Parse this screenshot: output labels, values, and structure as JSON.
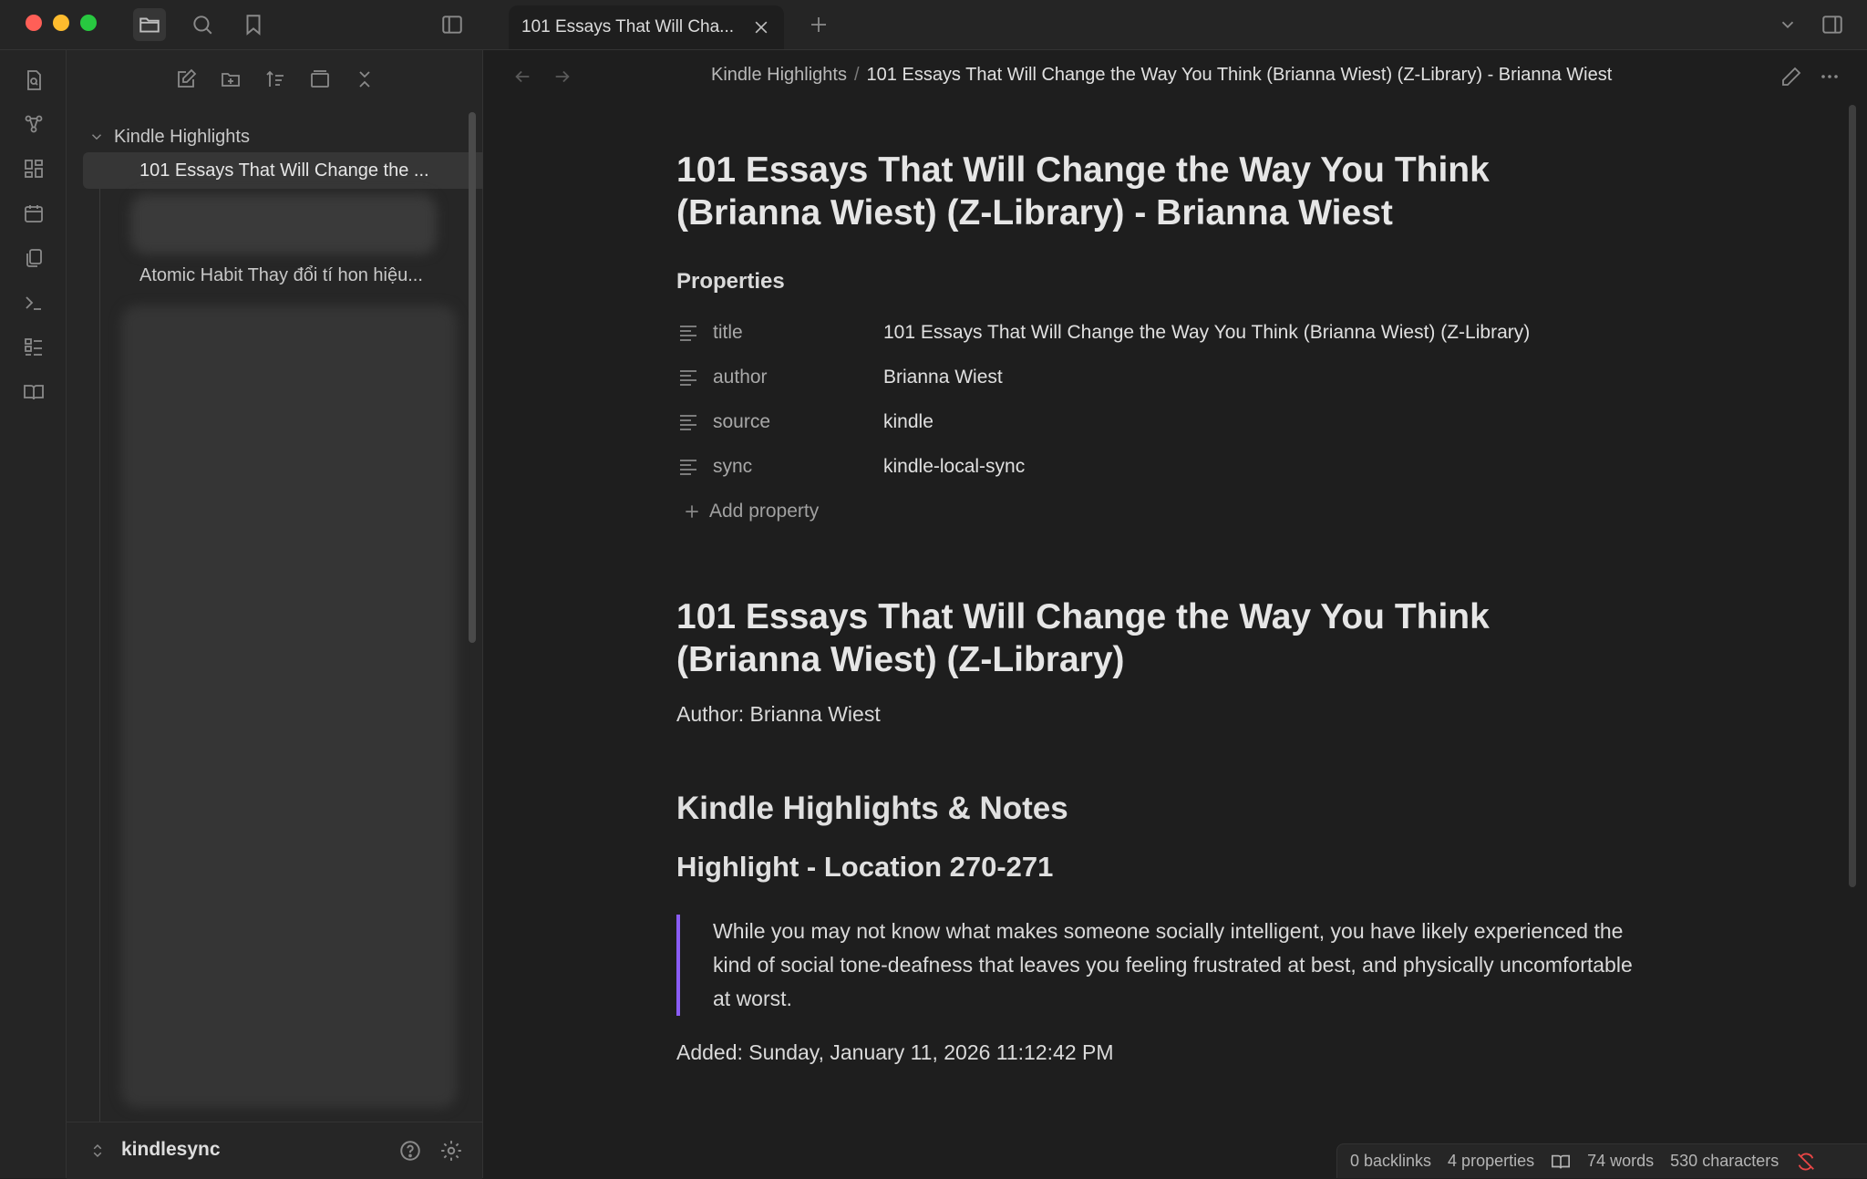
{
  "tab": {
    "title": "101 Essays That Will Cha..."
  },
  "explorer": {
    "folder": "Kindle Highlights",
    "files": [
      "101 Essays That Will Change the ...",
      "Atomic Habit Thay đổi tí hon hiệu..."
    ],
    "vault_name": "kindlesync"
  },
  "breadcrumb": {
    "parent": "Kindle Highlights",
    "separator": "/",
    "current": "101 Essays That Will Change the Way You Think (Brianna Wiest) (Z-Library) - Brianna Wiest"
  },
  "note": {
    "inline_title": "101 Essays That Will Change the Way You Think (Brianna Wiest) (Z-Library) - Brianna Wiest",
    "properties_heading": "Properties",
    "properties": [
      {
        "key": "title",
        "value": "101 Essays That Will Change the Way You Think (Brianna Wiest) (Z-Library)"
      },
      {
        "key": "author",
        "value": "Brianna Wiest"
      },
      {
        "key": "source",
        "value": "kindle"
      },
      {
        "key": "sync",
        "value": "kindle-local-sync"
      }
    ],
    "add_property_label": "Add property",
    "h1": "101 Essays That Will Change the Way You Think (Brianna Wiest) (Z-Library)",
    "author_line": "Author: Brianna Wiest",
    "h2": "Kindle Highlights & Notes",
    "h3": "Highlight - Location 270-271",
    "quote": "While you may not know what makes someone socially intelligent, you have likely experienced the kind of social tone-deafness that leaves you feeling frustrated at best, and physically uncomfortable at worst.",
    "added_line": "Added: Sunday, January 11, 2026 11:12:42 PM"
  },
  "status": {
    "backlinks": "0 backlinks",
    "properties": "4 properties",
    "words": "74 words",
    "characters": "530 characters"
  },
  "colors": {
    "accent": "#8a5cf5",
    "background": "#1e1e1e",
    "sidebar": "#262626",
    "sync_error": "#e84646"
  },
  "icons": {
    "titlebar": [
      "folder-icon",
      "search-icon",
      "bookmark-icon",
      "sidebar-toggle-icon",
      "close-icon",
      "plus-icon",
      "chevron-down-icon",
      "right-sidebar-icon"
    ],
    "ribbon": [
      "quick-switcher-icon",
      "graph-view-icon",
      "canvas-icon",
      "daily-note-icon",
      "templates-icon",
      "command-palette-icon",
      "bases-icon",
      "reading-icon"
    ],
    "explorer_nav": [
      "new-note-icon",
      "new-folder-icon",
      "sort-icon",
      "collapse-view-icon",
      "collapse-all-icon"
    ]
  }
}
